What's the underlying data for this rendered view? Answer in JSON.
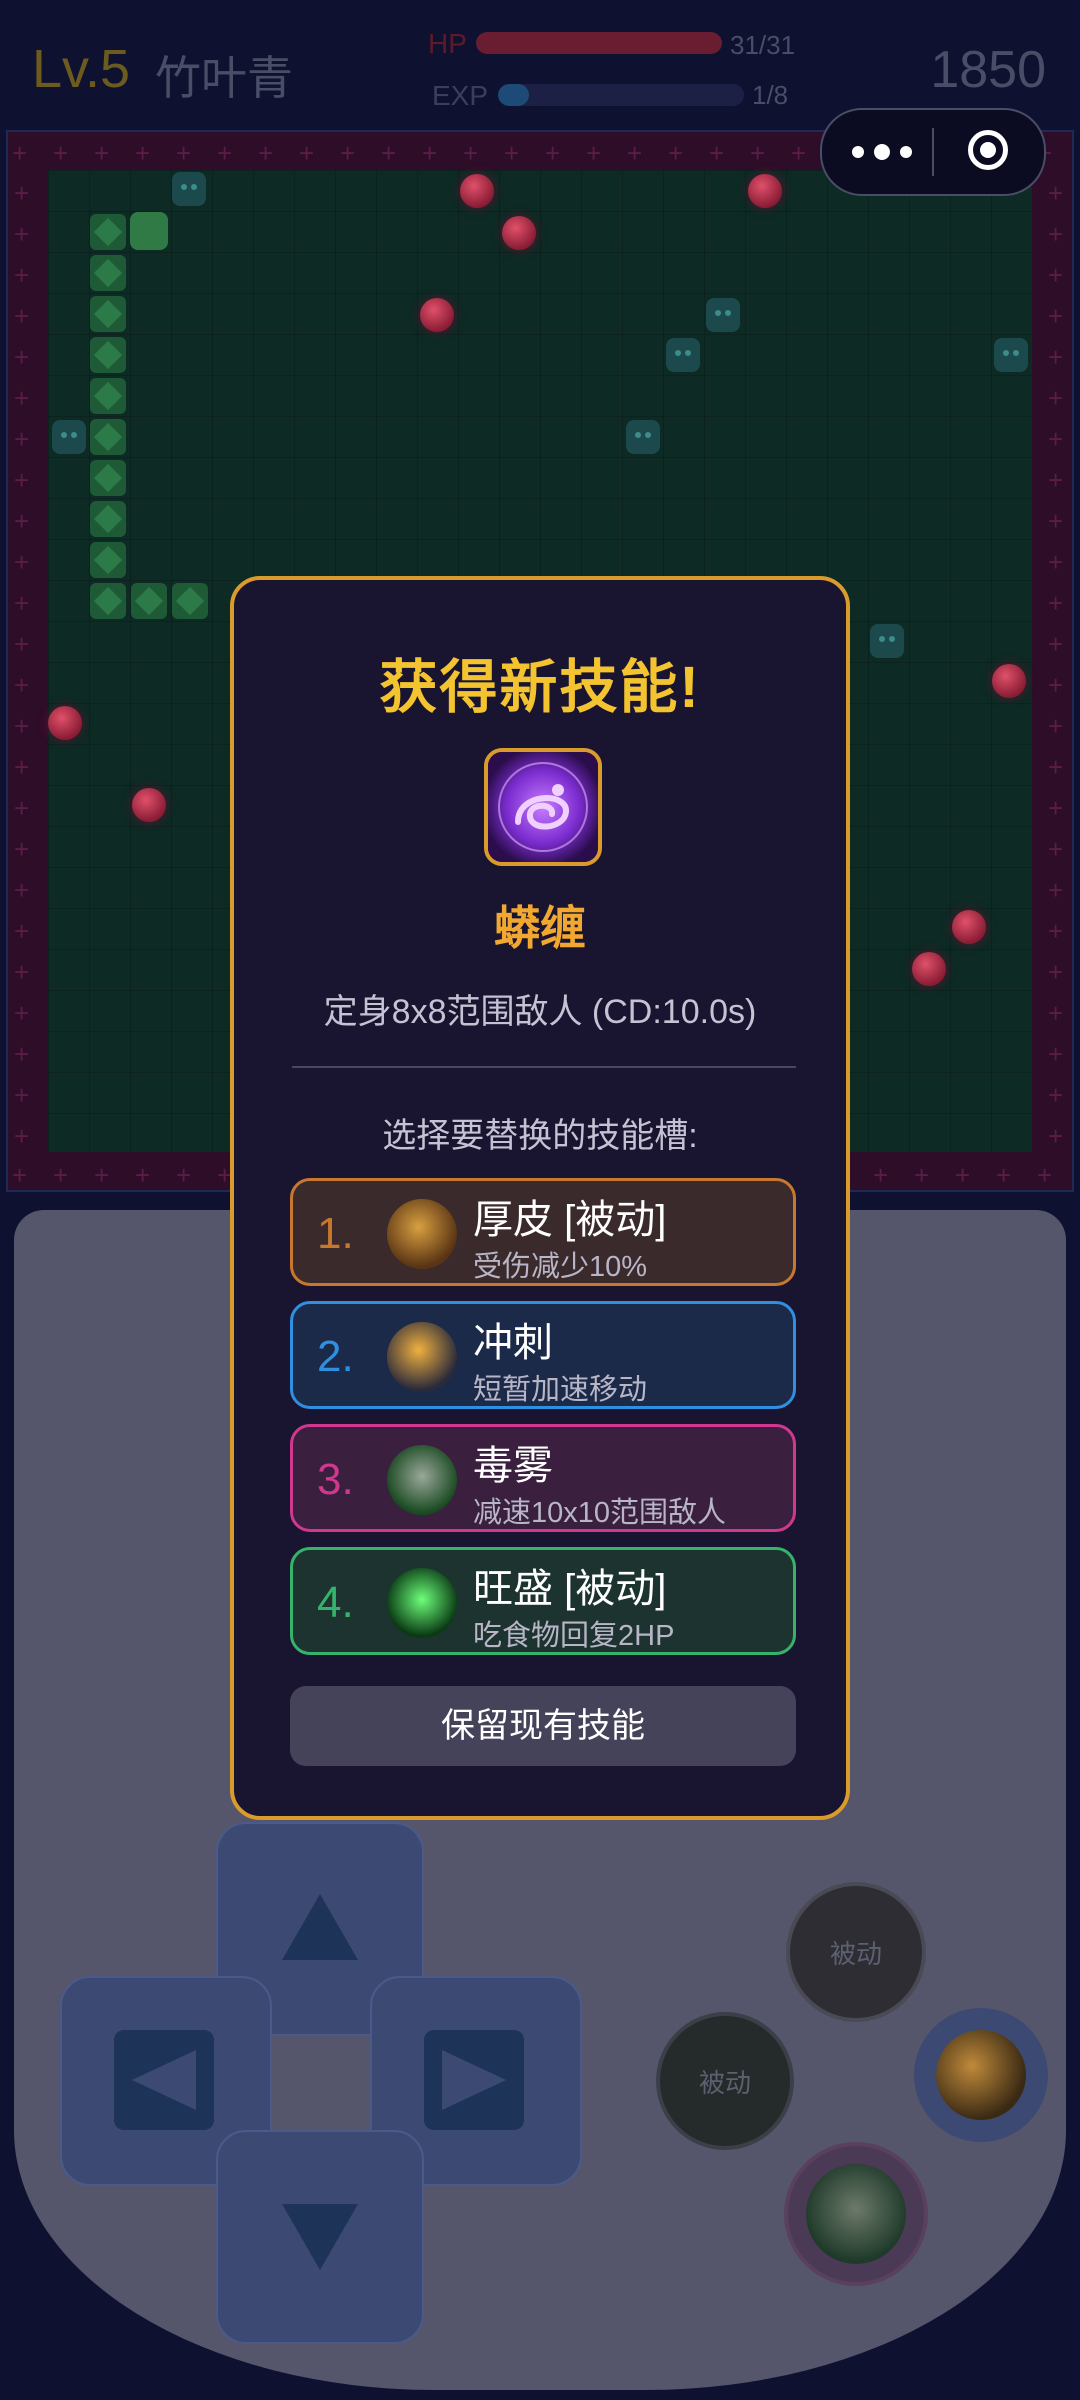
{
  "hud": {
    "level": "Lv.5",
    "player_name": "竹叶青",
    "hp_label": "HP",
    "hp_text": "31/31",
    "hp_fraction": 1.0,
    "exp_label": "EXP",
    "exp_text": "1/8",
    "exp_fraction": 0.125,
    "score": "1850"
  },
  "modal": {
    "title": "获得新技能!",
    "skill_name": "蟒缠",
    "skill_desc": "定身8x8范围敌人 (CD:10.0s)",
    "prompt": "选择要替换的技能槽:",
    "slots": [
      {
        "num": "1.",
        "name": "厚皮 [被动]",
        "desc": "受伤减少10%",
        "color": "#c7782c",
        "icon": "thick-skin-icon"
      },
      {
        "num": "2.",
        "name": "冲刺",
        "desc": "短暂加速移动",
        "color": "#2f8fe0",
        "icon": "dash-icon"
      },
      {
        "num": "3.",
        "name": "毒雾",
        "desc": "减速10x10范围敌人",
        "color": "#d0388f",
        "icon": "poison-fog-icon"
      },
      {
        "num": "4.",
        "name": "旺盛 [被动]",
        "desc": "吃食物回复2HP",
        "color": "#36b36a",
        "icon": "vigor-heart-icon"
      }
    ],
    "keep_label": "保留现有技能"
  },
  "controller": {
    "passive_label_1": "被动",
    "passive_label_2": "被动"
  },
  "colors": {
    "gold": "#f4c430",
    "hp": "#c83050",
    "exp": "#2f8fe0"
  }
}
